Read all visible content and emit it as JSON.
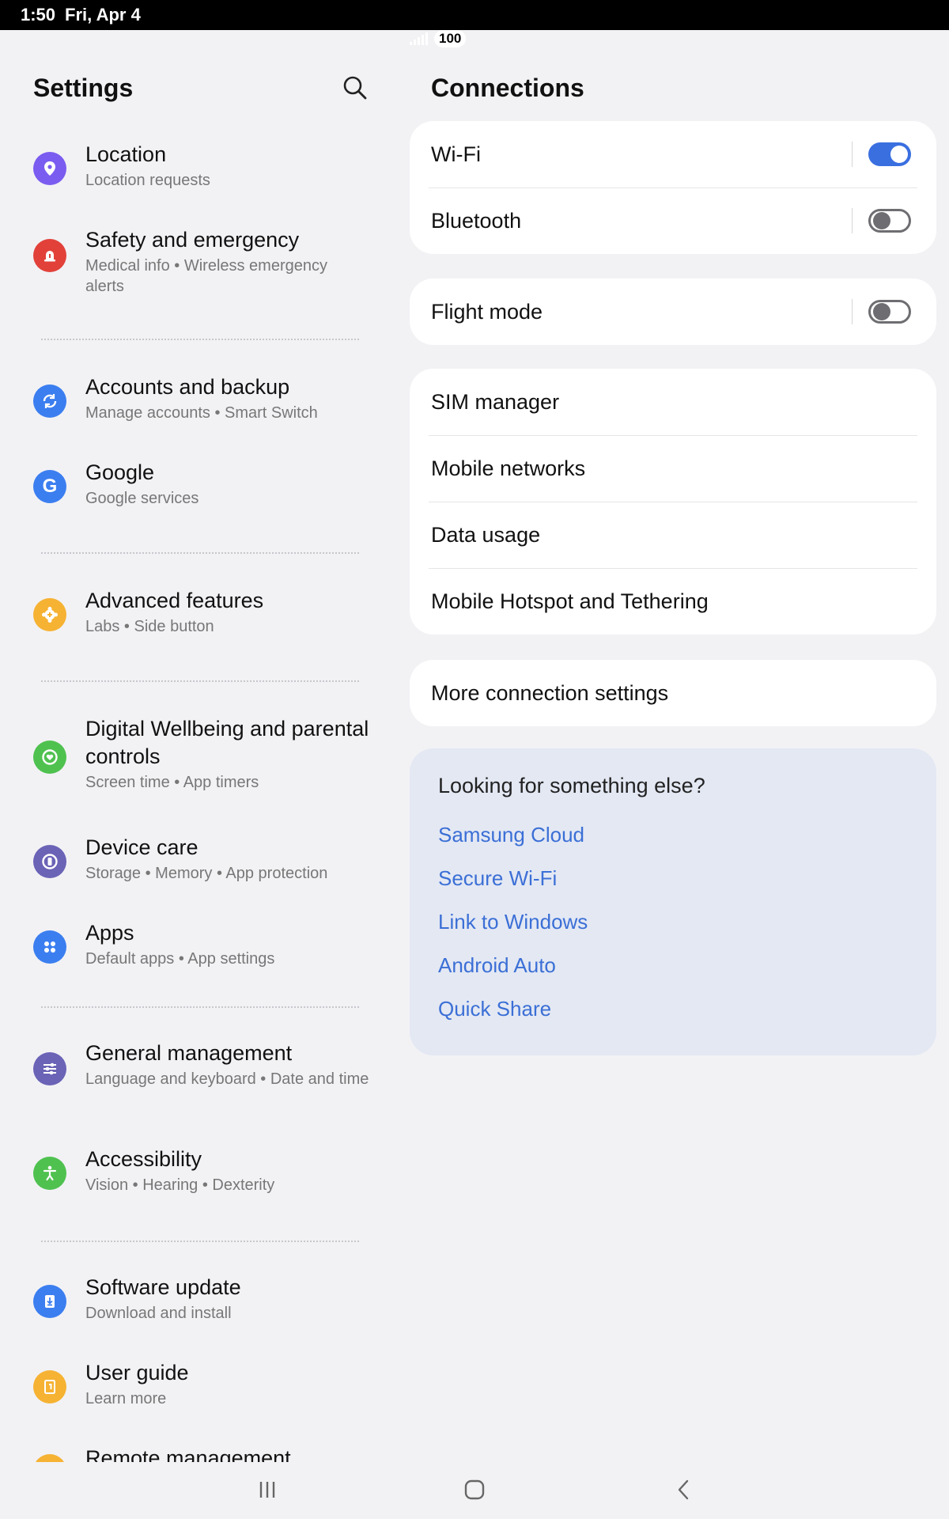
{
  "status": {
    "time": "1:50",
    "date": "Fri, Apr 4",
    "battery": "100"
  },
  "left": {
    "title": "Settings",
    "items": [
      {
        "title": "Location",
        "sub": "Location requests",
        "icon": "location-pin-icon",
        "color": "#7b5cf0"
      },
      {
        "title": "Safety and emergency",
        "sub": "Medical info  •  Wireless emergency alerts",
        "icon": "alert-icon",
        "color": "#e2413a"
      },
      {
        "title": "Accounts and backup",
        "sub": "Manage accounts  •  Smart Switch",
        "icon": "sync-icon",
        "color": "#3b7ef0"
      },
      {
        "title": "Google",
        "sub": "Google services",
        "icon": "google-icon",
        "color": "#3b7ef0"
      },
      {
        "title": "Advanced features",
        "sub": "Labs  •  Side button",
        "icon": "gear-plus-icon",
        "color": "#f6b233"
      },
      {
        "title": "Digital Wellbeing and parental controls",
        "sub": "Screen time  •  App timers",
        "icon": "wellbeing-icon",
        "color": "#4fc14f"
      },
      {
        "title": "Device care",
        "sub": "Storage  •  Memory  •  App protection",
        "icon": "device-care-icon",
        "color": "#6a63b6"
      },
      {
        "title": "Apps",
        "sub": "Default apps  •  App settings",
        "icon": "apps-grid-icon",
        "color": "#3b7ef0"
      },
      {
        "title": "General management",
        "sub": "Language and keyboard  •  Date and time",
        "icon": "sliders-icon",
        "color": "#6a63b6"
      },
      {
        "title": "Accessibility",
        "sub": "Vision  •  Hearing  •  Dexterity",
        "icon": "accessibility-icon",
        "color": "#4fc14f"
      },
      {
        "title": "Software update",
        "sub": "Download and install",
        "icon": "software-update-icon",
        "color": "#3b7ef0"
      },
      {
        "title": "User guide",
        "sub": "Learn more",
        "icon": "user-guide-icon",
        "color": "#f6b233"
      },
      {
        "title": "Remote management",
        "sub": "",
        "icon": "remote-icon",
        "color": "#f6b233"
      }
    ]
  },
  "right": {
    "title": "Connections",
    "wifi": {
      "label": "Wi-Fi",
      "on": true
    },
    "bluetooth": {
      "label": "Bluetooth",
      "on": false
    },
    "flight": {
      "label": "Flight mode",
      "on": false
    },
    "sim_manager": "SIM manager",
    "mobile_networks": "Mobile networks",
    "data_usage": "Data usage",
    "hotspot": "Mobile Hotspot and Tethering",
    "more": "More connection settings",
    "suggest": {
      "heading": "Looking for something else?",
      "links": [
        "Samsung Cloud",
        "Secure Wi-Fi",
        "Link to Windows",
        "Android Auto",
        "Quick Share"
      ]
    },
    "accent": "#3a6fe0"
  }
}
